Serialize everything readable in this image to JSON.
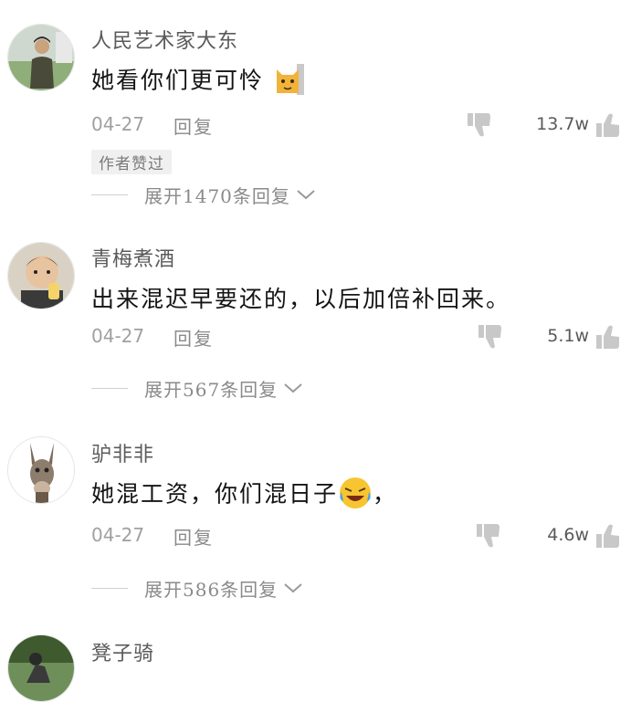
{
  "comments": [
    {
      "username": "人民艺术家大东",
      "text": "她看你们更可怜",
      "date": "04-27",
      "reply_label": "回复",
      "likes": "13.7w",
      "badge": "作者赞过",
      "expand_label": "展开1470条回复",
      "avatar_icon": "person-photo-avatar",
      "emoji": "cat-emoji"
    },
    {
      "username": "青梅煮酒",
      "text": "出来混迟早要还的，以后加倍补回来。",
      "date": "04-27",
      "reply_label": "回复",
      "likes": "5.1w",
      "expand_label": "展开567条回复",
      "avatar_icon": "child-photo-avatar"
    },
    {
      "username": "驴非非",
      "text": "她混工资，你们混日子",
      "text_suffix": "，",
      "date": "04-27",
      "reply_label": "回复",
      "likes": "4.6w",
      "expand_label": "展开586条回复",
      "avatar_icon": "donkey-avatar",
      "emoji": "laughing-crying-emoji"
    },
    {
      "username": "凳子骑",
      "avatar_icon": "rider-photo-avatar"
    }
  ],
  "colors": {
    "username": "#5a5a5a",
    "text": "#141414",
    "meta": "#a0a0a0",
    "icon": "#c8c8c8"
  }
}
